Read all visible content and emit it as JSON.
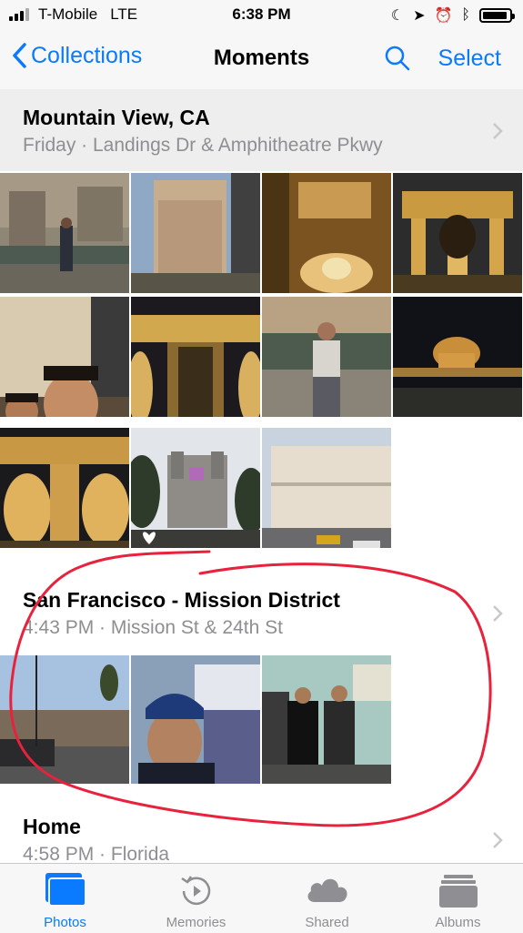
{
  "status": {
    "carrier": "T-Mobile",
    "network": "LTE",
    "time": "6:38 PM"
  },
  "nav": {
    "back_label": "Collections",
    "title": "Moments",
    "select_label": "Select"
  },
  "sections": [
    {
      "title": "Mountain View, CA",
      "subtitle": "Friday  ·  Landings Dr & Amphitheatre Pkwy"
    },
    {
      "title": "San Francisco - Mission District",
      "subtitle": "4:43 PM  ·  Mission St & 24th St"
    },
    {
      "title": "Home",
      "subtitle": "4:58 PM  ·  Florida"
    }
  ],
  "tabs": [
    {
      "label": "Photos",
      "active": true
    },
    {
      "label": "Memories",
      "active": false
    },
    {
      "label": "Shared",
      "active": false
    },
    {
      "label": "Albums",
      "active": false
    }
  ],
  "colors": {
    "accent": "#0a7aff",
    "annotation": "#e8223c",
    "secondary_text": "#8e8e93"
  }
}
